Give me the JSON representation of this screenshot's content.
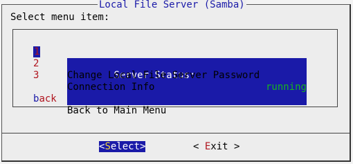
{
  "dialog": {
    "title": "Local File Server (Samba)",
    "prompt": "Select menu item:"
  },
  "menu": {
    "items": [
      {
        "tag": "1",
        "label": "Server Status:",
        "status": "running",
        "selected": true
      },
      {
        "tag": "2",
        "label": "Change Local File Server Password"
      },
      {
        "tag": "3",
        "label": "Connection Info"
      },
      {
        "tag_hotkey": "b",
        "tag_rest": "ack",
        "label": "Back to Main Menu"
      }
    ]
  },
  "buttons": {
    "select": {
      "open": "<",
      "hotkey": "S",
      "rest": "elect",
      "close": ">"
    },
    "exit": {
      "open": "< ",
      "hotkey": "E",
      "rest": "xit",
      "close": " >"
    }
  },
  "colors": {
    "accent_blue": "#1a1aa8",
    "tag_red": "#b0141e",
    "status_green": "#16b41e",
    "hotkey_yellow": "#f2d43a",
    "dialog_bg": "#ededed"
  }
}
